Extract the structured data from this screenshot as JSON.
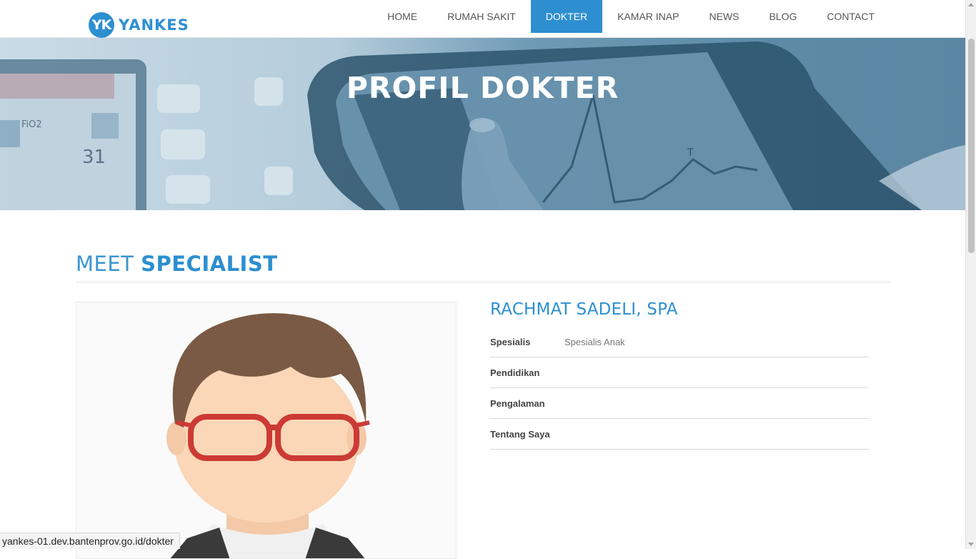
{
  "brand": {
    "badge": "YK",
    "name": "YANKES"
  },
  "nav": {
    "items": [
      {
        "label": "HOME",
        "active": false
      },
      {
        "label": "RUMAH SAKIT",
        "active": false
      },
      {
        "label": "DOKTER",
        "active": true
      },
      {
        "label": "KAMAR INAP",
        "active": false
      },
      {
        "label": "NEWS",
        "active": false
      },
      {
        "label": "BLOG",
        "active": false
      },
      {
        "label": "CONTACT",
        "active": false
      }
    ]
  },
  "hero": {
    "title": "PROFIL DOKTER"
  },
  "section": {
    "title_light": "MEET",
    "title_bold": "SPECIALIST"
  },
  "doctor": {
    "name": "RACHMAT SADELI, SPA",
    "fields": [
      {
        "label": "Spesialis",
        "value": "Spesialis Anak"
      },
      {
        "label": "Pendidikan",
        "value": ""
      },
      {
        "label": "Pengalaman",
        "value": ""
      },
      {
        "label": "Tentang Saya",
        "value": ""
      }
    ]
  },
  "statusbar": {
    "url": "yankes-01.dev.bantenprov.go.id/dokter"
  },
  "colors": {
    "accent": "#2d8fd0",
    "hero_overlay": "#5b87a4"
  }
}
